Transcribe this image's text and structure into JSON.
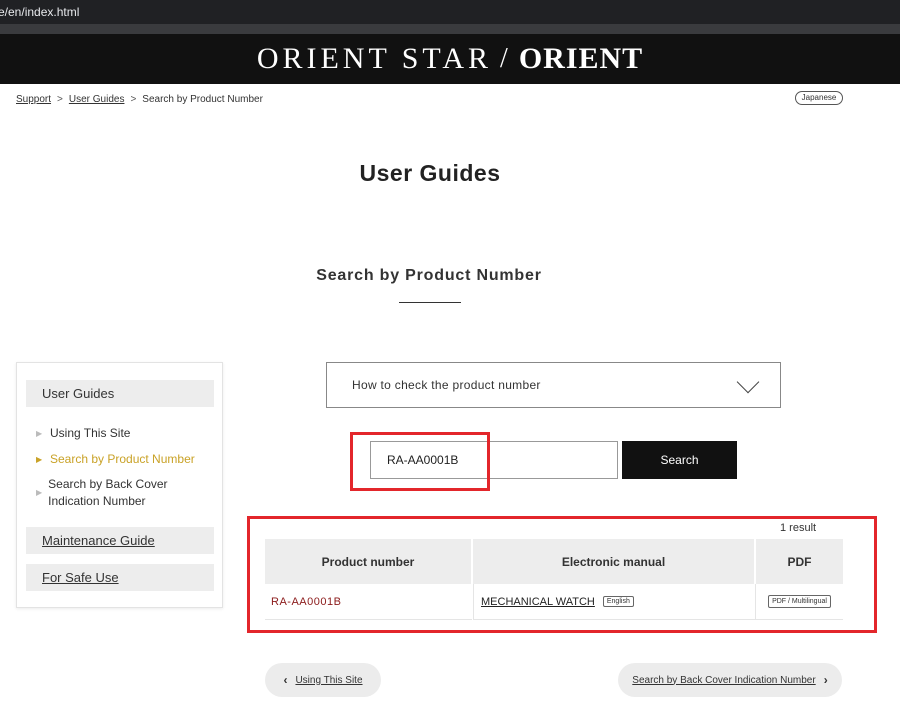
{
  "browser": {
    "url": "e/en/index.html"
  },
  "brand": {
    "left": "ORIENT STAR",
    "divider": "/",
    "right": "ORIENT"
  },
  "breadcrumb": {
    "support": "Support",
    "user_guides": "User Guides",
    "current": "Search by Product Number",
    "sep": ">"
  },
  "language_button": "Japanese",
  "page_title": "User Guides",
  "section_title": "Search by Product Number",
  "sidebar": {
    "header": "User Guides",
    "items": [
      {
        "label": "Using This Site"
      },
      {
        "label": "Search by Product Number"
      },
      {
        "label": "Search by Back Cover Indication Number"
      }
    ],
    "maintenance": "Maintenance Guide",
    "safe_use": "For Safe Use"
  },
  "howto": {
    "label": "How to check the product number"
  },
  "search": {
    "value": "RA-AA0001B",
    "button": "Search"
  },
  "results": {
    "count": "1 result",
    "headers": [
      "Product number",
      "Electronic manual",
      "PDF"
    ],
    "rows": [
      {
        "product": "RA-AA0001B",
        "manual": "MECHANICAL WATCH",
        "manual_lang": "English",
        "pdf": "PDF / Multilingual"
      }
    ]
  },
  "pager": {
    "prev": "Using This Site",
    "next": "Search by Back Cover Indication Number"
  },
  "colors": {
    "highlight": "#e3262b",
    "active_link": "#c9a227",
    "product_link": "#8b1a1a",
    "header_bg": "#111111"
  }
}
